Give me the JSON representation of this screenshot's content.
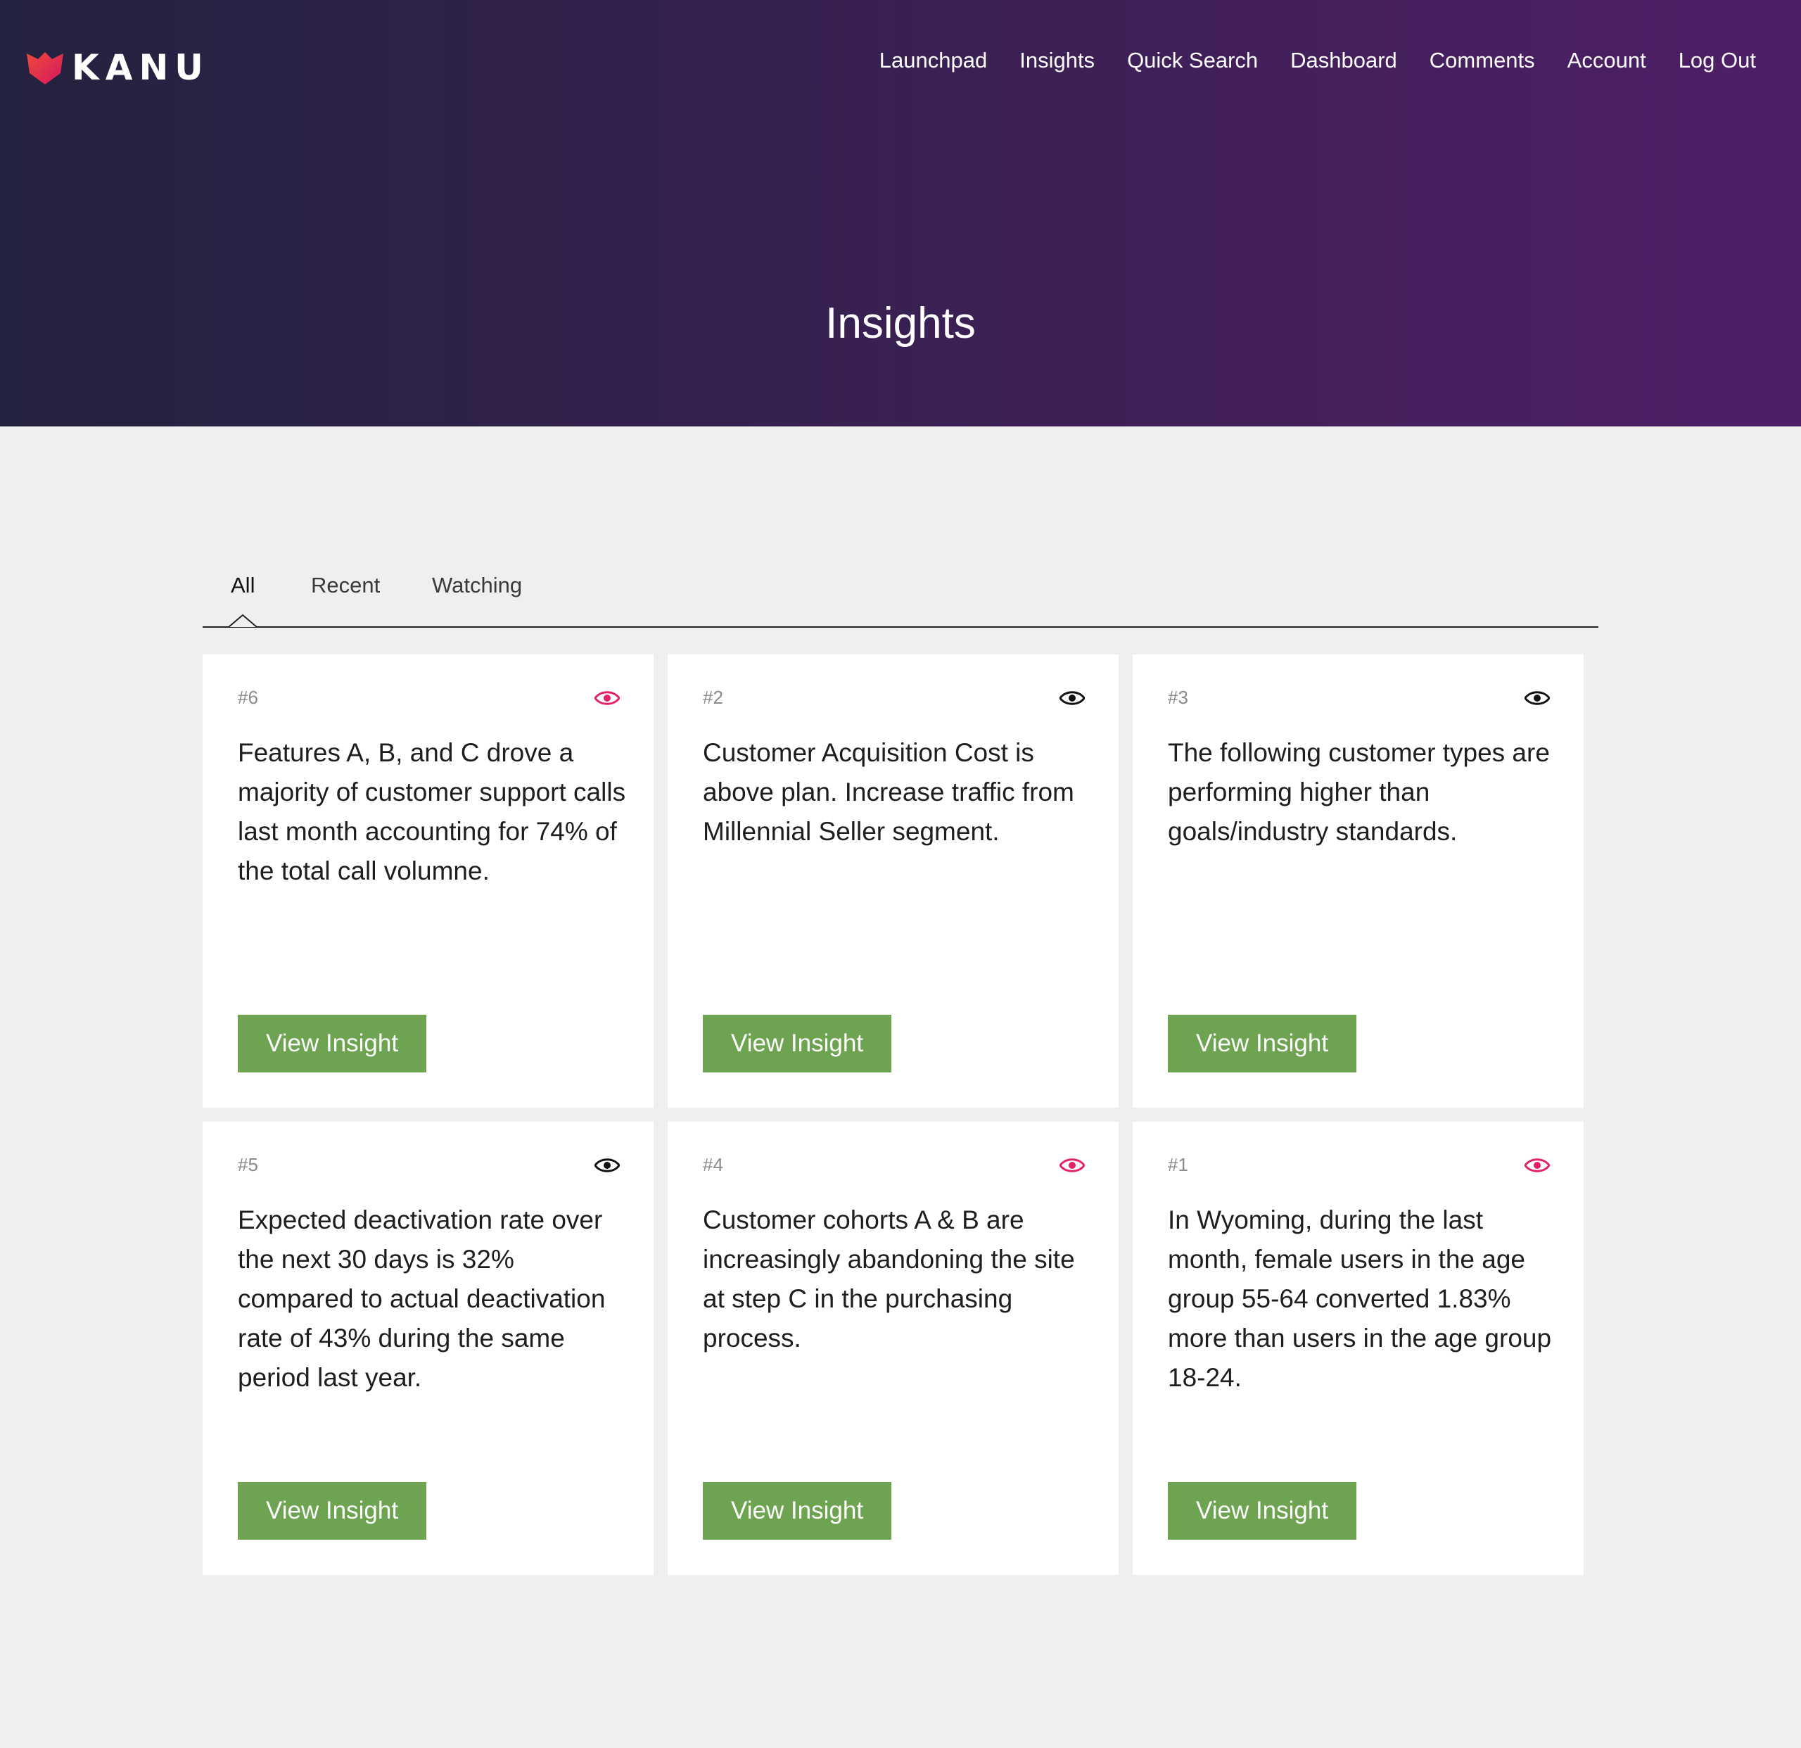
{
  "header": {
    "logo_text": "KANU",
    "nav": [
      "Launchpad",
      "Insights",
      "Quick Search",
      "Dashboard",
      "Comments",
      "Account",
      "Log Out"
    ],
    "title": "Insights"
  },
  "colors": {
    "hero_gradient": [
      "#23223f",
      "#4f1f66"
    ],
    "button_green": "#6ea451",
    "eye_watching": "#e5206b",
    "eye_default": "#111111",
    "logo_accent": "#ee4a3a"
  },
  "tabs": {
    "items": [
      "All",
      "Recent",
      "Watching"
    ],
    "active": "All"
  },
  "cards": [
    {
      "number": "#6",
      "text": "Features A, B, and C drove a majority of customer support calls last month accounting for 74% of the total call volumne.",
      "button": "View Insight",
      "watching": true,
      "icon": "eye-icon"
    },
    {
      "number": "#2",
      "text": "Customer Acquisition Cost is above plan. Increase traffic from Millennial Seller segment.",
      "button": "View Insight",
      "watching": false,
      "icon": "eye-icon"
    },
    {
      "number": "#3",
      "text": "The following customer types are performing higher than goals/industry standards.",
      "button": "View Insight",
      "watching": false,
      "icon": "eye-icon"
    },
    {
      "number": "#5",
      "text": "Expected deactivation rate over the next 30 days is 32% compared to actual deactivation rate of 43% during the same period last year.",
      "button": "View Insight",
      "watching": false,
      "icon": "eye-icon"
    },
    {
      "number": "#4",
      "text": "Customer cohorts A & B are increasingly abandoning the site at step C in the purchasing process.",
      "button": "View Insight",
      "watching": true,
      "icon": "eye-icon"
    },
    {
      "number": "#1",
      "text": "In Wyoming, during the last month, female users in the age group 55-64 converted 1.83% more than users in the age group 18-24.",
      "button": "View Insight",
      "watching": true,
      "icon": "eye-icon"
    }
  ]
}
